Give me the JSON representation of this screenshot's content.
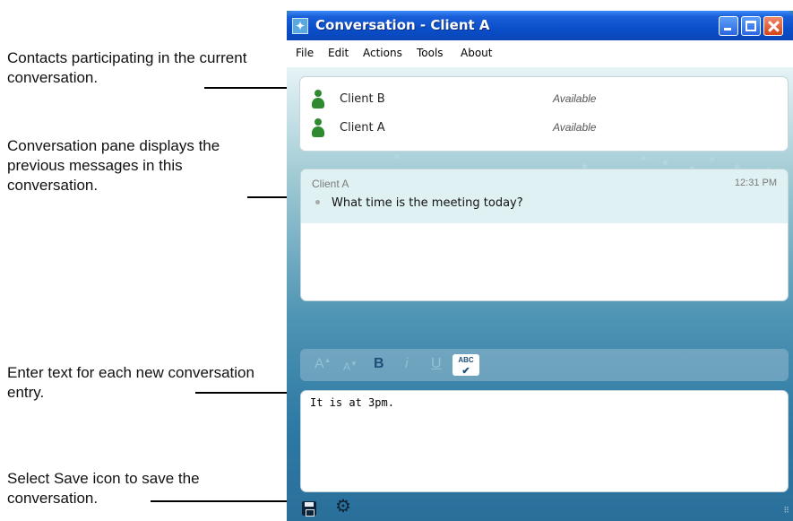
{
  "annotations": {
    "contacts": "Contacts participating in the current conversation.",
    "conversation_pane": "Conversation pane displays the previous messages in this conversation.",
    "enter_text": "Enter text for each new conversation entry.",
    "save_icon": "Select Save icon to save the conversation."
  },
  "window": {
    "title": "Conversation - Client A"
  },
  "menu": {
    "items": [
      "File",
      "Edit",
      "Actions",
      "Tools",
      "About"
    ]
  },
  "contacts": [
    {
      "name": "Client B",
      "status": "Available",
      "icon": "person-icon"
    },
    {
      "name": "Client A",
      "status": "Available",
      "icon": "person-icon"
    }
  ],
  "conversation": {
    "messages": [
      {
        "sender": "Client A",
        "time": "12:31 PM",
        "text": "What time is the meeting today?"
      }
    ]
  },
  "format_toolbar": {
    "grow_font": "A",
    "shrink_font": "A",
    "bold": "B",
    "italic": "i",
    "underline": "U",
    "spellcheck": "ABC"
  },
  "input": {
    "value": "It is at 3pm."
  },
  "colors": {
    "titlebar": "#0a4ec9",
    "contact_icon": "#2f8a2f",
    "content_bg": "#3b7ea6"
  }
}
